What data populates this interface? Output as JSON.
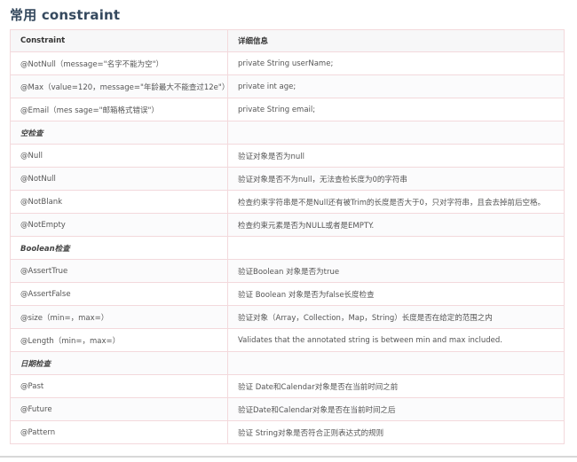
{
  "title": "常用 constraint",
  "table": {
    "headers": [
      "Constraint",
      "详细信息"
    ],
    "rows": [
      {
        "c1": "@NotNull（message=\"名字不能为空\"）",
        "c2": "private String userName;",
        "section": false
      },
      {
        "c1": "@Max（value=120，message=\"年龄最大不能查过12e\"）",
        "c2": "private int age;",
        "section": false
      },
      {
        "c1": "@Email（mes sage=\"邮箱格式错误\"）",
        "c2": "private String email;",
        "section": false
      },
      {
        "c1": "空检查",
        "c2": "",
        "section": true
      },
      {
        "c1": "@Null",
        "c2": "验证对象是否为null",
        "section": false
      },
      {
        "c1": "@NotNull",
        "c2": "验证对象是否不为null，无法查检长度为0的字符串",
        "section": false
      },
      {
        "c1": "@NotBlank",
        "c2": "检查约束字符串是不是Null还有被Trim的长度是否大于0，只对字符串，且会去掉前后空格。",
        "section": false
      },
      {
        "c1": "@NotEmpty",
        "c2": "检查约束元素是否为NULL或者是EMPTY.",
        "section": false
      },
      {
        "c1": "Boolean检查",
        "c2": "",
        "section": true
      },
      {
        "c1": "@AssertTrue",
        "c2": "验证Boolean 对象是否为true",
        "section": false
      },
      {
        "c1": "@AssertFalse",
        "c2": "验证 Boolean 对象是否为false长度检查",
        "section": false
      },
      {
        "c1": "@size（min=，max=）",
        "c2": "验证对象（Array，Collection，Map，String）长度是否在给定的范围之内",
        "section": false
      },
      {
        "c1": "@Length（min=，max=）",
        "c2": "Validates that the annotated string is between min and max included.",
        "section": false
      },
      {
        "c1": "日期检查",
        "c2": "",
        "section": true
      },
      {
        "c1": "@Past",
        "c2": "验证 Date和Calendar对象是否在当前时间之前",
        "section": false
      },
      {
        "c1": "@Future",
        "c2": "验证Date和Calendar对象是否在当前时间之后",
        "section": false
      },
      {
        "c1": "@Pattern",
        "c2": "验证 String对象是否符合正则表达式的规则",
        "section": false
      }
    ]
  }
}
